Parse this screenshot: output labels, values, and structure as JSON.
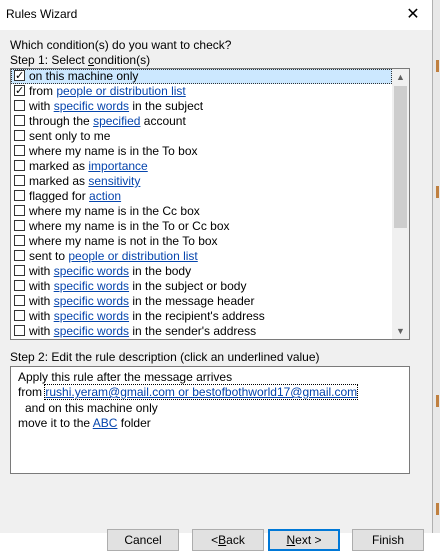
{
  "window": {
    "title": "Rules Wizard",
    "close_glyph": "✕"
  },
  "step1": {
    "question": "Which condition(s) do you want to check?",
    "label_prefix": "Step 1: Select ",
    "label_underlined": "c",
    "label_suffix": "ondition(s)"
  },
  "conditions": [
    {
      "checked": true,
      "selected": true,
      "before": "on this machine only",
      "link": "",
      "after": ""
    },
    {
      "checked": true,
      "selected": false,
      "before": "from ",
      "link": "people or distribution list",
      "after": ""
    },
    {
      "checked": false,
      "selected": false,
      "before": "with ",
      "link": "specific words",
      "after": " in the subject"
    },
    {
      "checked": false,
      "selected": false,
      "before": "through the ",
      "link": "specified",
      "after": " account"
    },
    {
      "checked": false,
      "selected": false,
      "before": "sent only to me",
      "link": "",
      "after": ""
    },
    {
      "checked": false,
      "selected": false,
      "before": "where my name is in the To box",
      "link": "",
      "after": ""
    },
    {
      "checked": false,
      "selected": false,
      "before": "marked as ",
      "link": "importance",
      "after": ""
    },
    {
      "checked": false,
      "selected": false,
      "before": "marked as ",
      "link": "sensitivity",
      "after": ""
    },
    {
      "checked": false,
      "selected": false,
      "before": "flagged for ",
      "link": "action",
      "after": ""
    },
    {
      "checked": false,
      "selected": false,
      "before": "where my name is in the Cc box",
      "link": "",
      "after": ""
    },
    {
      "checked": false,
      "selected": false,
      "before": "where my name is in the To or Cc box",
      "link": "",
      "after": ""
    },
    {
      "checked": false,
      "selected": false,
      "before": "where my name is not in the To box",
      "link": "",
      "after": ""
    },
    {
      "checked": false,
      "selected": false,
      "before": "sent to ",
      "link": "people or distribution list",
      "after": ""
    },
    {
      "checked": false,
      "selected": false,
      "before": "with ",
      "link": "specific words",
      "after": " in the body"
    },
    {
      "checked": false,
      "selected": false,
      "before": "with ",
      "link": "specific words",
      "after": " in the subject or body"
    },
    {
      "checked": false,
      "selected": false,
      "before": "with ",
      "link": "specific words",
      "after": " in the message header"
    },
    {
      "checked": false,
      "selected": false,
      "before": "with ",
      "link": "specific words",
      "after": " in the recipient's address"
    },
    {
      "checked": false,
      "selected": false,
      "before": "with ",
      "link": "specific words",
      "after": " in the sender's address"
    }
  ],
  "scrollbar": {
    "up_glyph": "▲",
    "down_glyph": "▼",
    "thumb_position": 0.0
  },
  "step2": {
    "label": "Step 2: Edit the rule description (click an underlined value)",
    "line1": "Apply this rule after the message arrives",
    "line2_before": "from ",
    "line2_link": "rushi.yeram@gmail.com or bestofbothworld17@gmail.com",
    "line3": "and on this machine only",
    "line4_before": "move it to the ",
    "line4_link": "ABC",
    "line4_after": " folder"
  },
  "buttons": {
    "cancel": "Cancel",
    "back_prefix": "< ",
    "back_underlined": "B",
    "back_suffix": "ack",
    "next_underlined": "N",
    "next_suffix": "ext >",
    "finish": "Finish"
  }
}
